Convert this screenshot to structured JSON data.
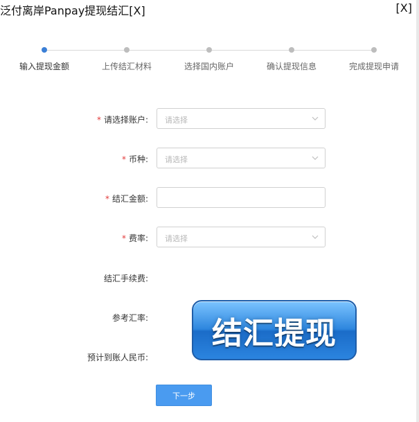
{
  "window": {
    "title": "泛付离岸Panpay提现结汇[X]",
    "close_label": "[X]"
  },
  "steps": [
    {
      "label": "输入提现金额",
      "active": true
    },
    {
      "label": "上传结汇材料",
      "active": false
    },
    {
      "label": "选择国内账户",
      "active": false
    },
    {
      "label": "确认提现信息",
      "active": false
    },
    {
      "label": "完成提现申请",
      "active": false
    }
  ],
  "form": {
    "account_label": "请选择账户:",
    "account_placeholder": "请选择",
    "currency_label": "币种:",
    "currency_placeholder": "请选择",
    "amount_label": "结汇金额:",
    "amount_value": "",
    "rate_label": "费率:",
    "rate_placeholder": "请选择",
    "fee_label": "结汇手续费:",
    "exchange_rate_label": "参考汇率:",
    "estimated_label": "预计到账人民币:"
  },
  "buttons": {
    "next_label": "下一步"
  },
  "promo": {
    "text": "结汇提现"
  },
  "colors": {
    "accent": "#3b7fd6",
    "button": "#4a9bf0",
    "required": "#e23b3b"
  },
  "icons": {
    "select": "chevron-down-icon"
  }
}
